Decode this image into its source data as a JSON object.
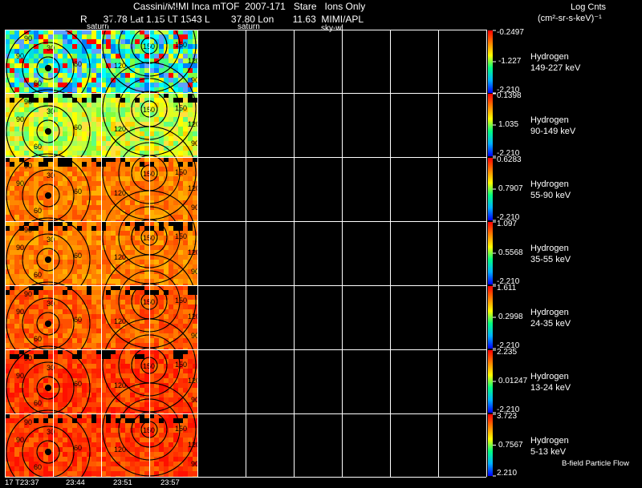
{
  "header": {
    "title": "Cassini/MIMI Inca mTOF  2007-171   Stare   Ions Only",
    "coords": "R      37.78 Lat 1.15 LT 1543 L        37.80 Lon       11.63  MIMI/APL",
    "saturn_label_1": "saturn",
    "saturn_label_2": "saturn",
    "sky_label": "sky-wl",
    "units_line1": "Log Cnts",
    "units_line2": "(cm²-sr-s-keV)⁻¹"
  },
  "time_axis": {
    "labels": [
      "17 T23:37",
      "23:44",
      "23:51",
      "23:57"
    ]
  },
  "contour_labels": [
    "30",
    "60",
    "90",
    "120",
    "150"
  ],
  "bands": [
    {
      "species": "Hydrogen",
      "range": "149-227 keV",
      "max": "-0.2497",
      "mid": "-1.227",
      "min": "-2.210",
      "palette": "mixed"
    },
    {
      "species": "Hydrogen",
      "range": "90-149 keV",
      "max": "0.1398",
      "mid": "1.035",
      "min": "-2.210",
      "palette": "yellowgreen"
    },
    {
      "species": "Hydrogen",
      "range": "55-90 keV",
      "max": "0.6283",
      "mid": "0.7907",
      "min": "-2.210",
      "palette": "orange"
    },
    {
      "species": "Hydrogen",
      "range": "35-55 keV",
      "max": "1.097",
      "mid": "0.5568",
      "min": "-2.210",
      "palette": "orange"
    },
    {
      "species": "Hydrogen",
      "range": "24-35 keV",
      "max": "1.611",
      "mid": "0.2998",
      "min": "-2.210",
      "palette": "orangered"
    },
    {
      "species": "Hydrogen",
      "range": "13-24 keV",
      "max": "2.235",
      "mid": "0.01247",
      "min": "-2.210",
      "palette": "red"
    },
    {
      "species": "Hydrogen",
      "range": "5-13 keV",
      "max": "3.723",
      "mid": "0.7567",
      "min": "2.210",
      "palette": "red"
    }
  ],
  "footer_note": "B-field Particle Flow",
  "colors": {
    "background": "#000000",
    "grid": "#ffffff",
    "colorbar": [
      "#0000ff",
      "#00b0ff",
      "#00ff80",
      "#ffff00",
      "#ff8000",
      "#ff0000"
    ]
  }
}
